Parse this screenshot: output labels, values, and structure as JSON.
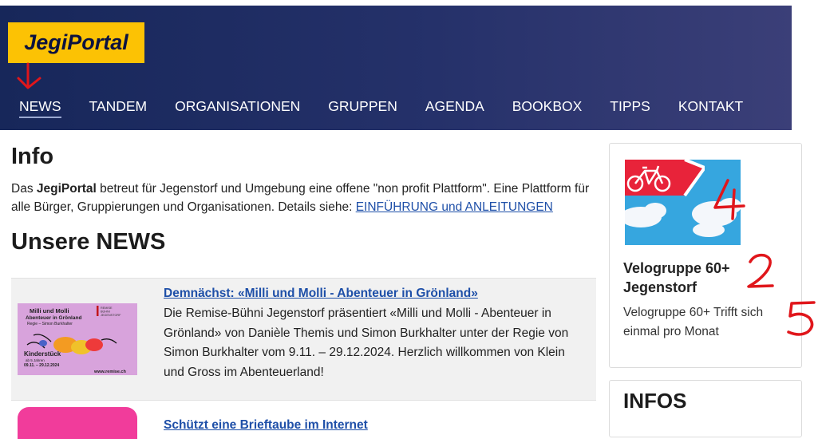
{
  "header": {
    "logo": "JegiPortal",
    "nav": [
      "NEWS",
      "TANDEM",
      "ORGANISATIONEN",
      "GRUPPEN",
      "AGENDA",
      "BOOKBOX",
      "TIPPS",
      "KONTAKT"
    ]
  },
  "info": {
    "title": "Info",
    "text_before": "Das ",
    "brand": "JegiPortal",
    "text_after": " betreut für Jegenstorf und Umgebung eine offene \"non profit Plattform\". Eine Plattform für alle Bürger, Gruppierungen und Organisationen. Details siehe: ",
    "link": "EINFÜHRUNG und ANLEITUNGEN"
  },
  "news": {
    "title": "Unsere NEWS",
    "items": [
      {
        "title": "Demnächst: «Milli und Molli - Abenteuer in Grönland»",
        "text": "Die Remise-Bühni Jegenstorf präsentiert «Milli und Molli - Abenteuer in Grönland» von Danièle Themis und Simon Burkhalter unter der Regie von Simon Burkhalter vom 9.11. – 29.12.2024. Herzlich willkommen von Klein und Gross im Abenteuerland!",
        "poster": {
          "title": "Milli und Molli\nAbenteuer in Grönland",
          "director": "Regie – Simon Burkhalter",
          "kind": "Kinderstück",
          "age": "ab 5 Jahren",
          "dates": "09.11. – 29.12.2024",
          "url": "www.remise.ch",
          "org": "REMISE\nBÜHNI\nJEGENSTORF"
        }
      },
      {
        "title": "Schützt eine Brieftaube im Internet"
      }
    ]
  },
  "sidebar": {
    "card": {
      "title": "Velogruppe 60+ Jegenstorf",
      "text": "Velogruppe 60+ Trifft sich einmal pro Monat"
    },
    "infos_title": "INFOS"
  },
  "annotations": [
    "4",
    "2",
    "5"
  ],
  "colors": {
    "header_start": "#17275a",
    "header_end": "#3b3f78",
    "logo_bg": "#fcc204",
    "link": "#1e4fa8",
    "annotation": "#e0161b"
  }
}
